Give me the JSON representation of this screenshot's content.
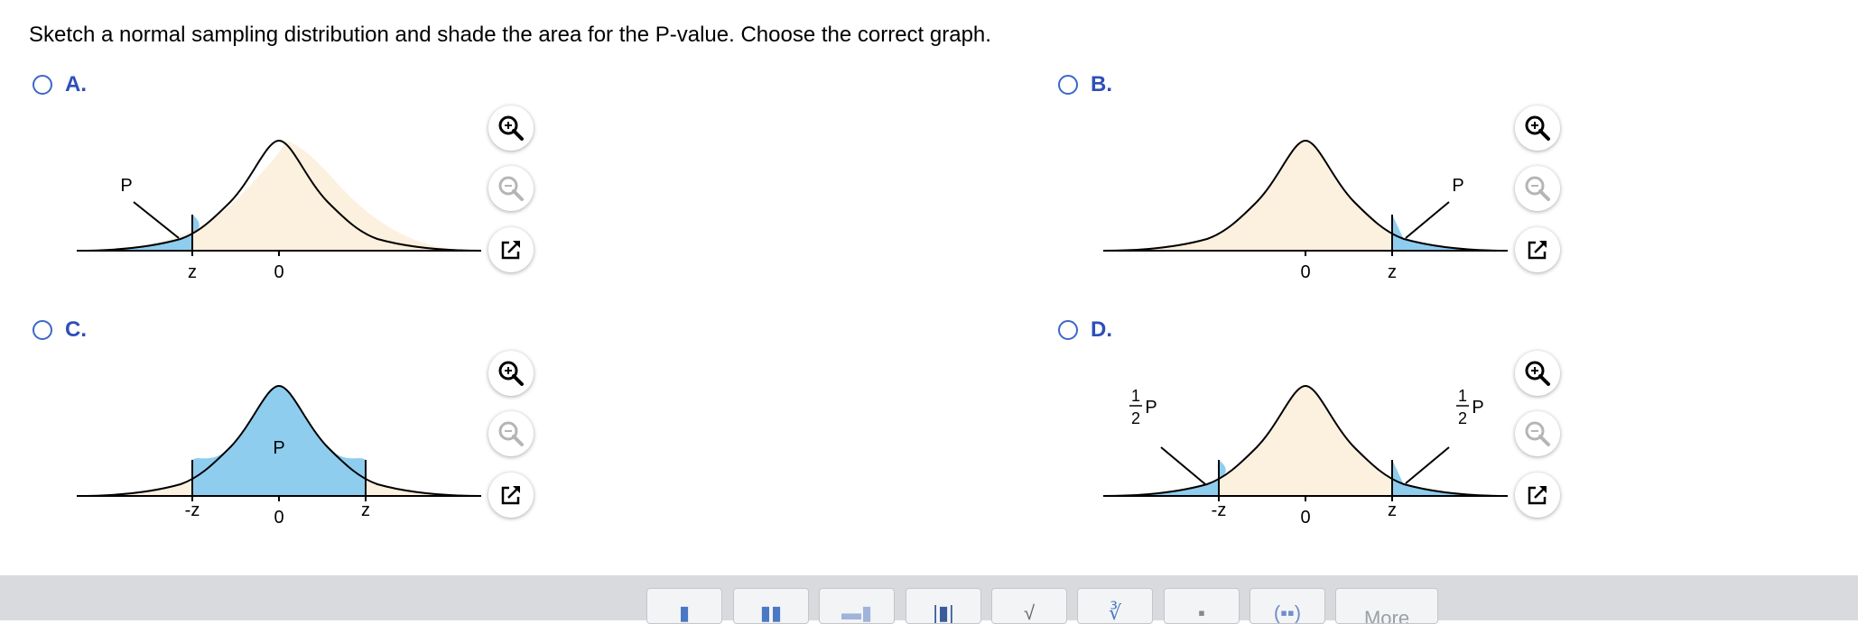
{
  "question": "Sketch a normal sampling distribution and shade the area for the P-value. Choose the correct graph.",
  "options": [
    {
      "letter": "A.",
      "selected": false,
      "shade": "left-tail",
      "ticks": {
        "z": "z",
        "zero": "0"
      },
      "area_label": "P"
    },
    {
      "letter": "B.",
      "selected": false,
      "shade": "right-tail",
      "ticks": {
        "z": "z",
        "zero": "0"
      },
      "area_label": "P"
    },
    {
      "letter": "C.",
      "selected": false,
      "shade": "center",
      "ticks": {
        "neg_z": "-z",
        "zero": "0",
        "z": "z"
      },
      "area_label": "P"
    },
    {
      "letter": "D.",
      "selected": false,
      "shade": "two-tails",
      "ticks": {
        "neg_z": "-z",
        "zero": "0",
        "z": "z"
      },
      "tail_label": {
        "num": "1",
        "den": "2",
        "sym": "P"
      }
    }
  ],
  "graph_controls": [
    "zoom-in-icon",
    "zoom-out-icon",
    "open-window-icon"
  ],
  "toolbar": {
    "buttons": [
      "fraction-icon",
      "mixed-number-icon",
      "superscript-icon",
      "absolute-value-icon",
      "square-root-icon",
      "nth-root-icon",
      "decimal-icon",
      "parentheses-icon"
    ],
    "more_label": "More"
  },
  "colors": {
    "curve_fill": "#fcf0df",
    "shade_fill": "#8fcdef",
    "accent": "#2d4fb8",
    "bar": "#d9dadd"
  }
}
